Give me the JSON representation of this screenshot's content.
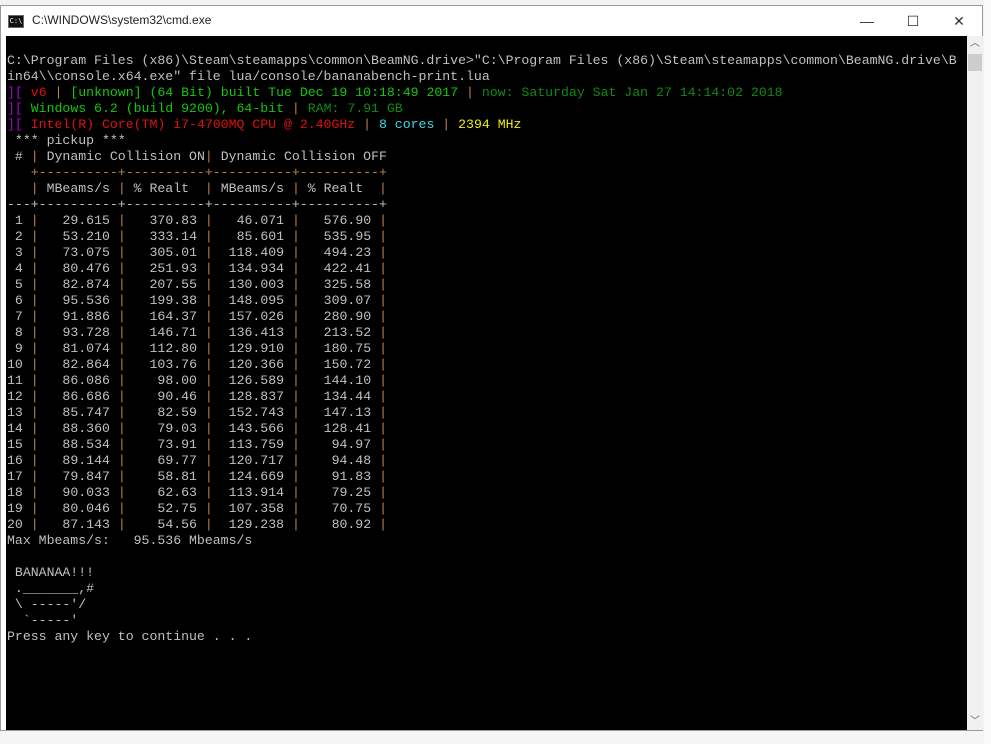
{
  "window": {
    "title": "C:\\WINDOWS\\system32\\cmd.exe",
    "icon_text": "C:\\",
    "minimize": "—",
    "maximize": "☐",
    "close": "✕"
  },
  "console": {
    "command_line_1": "C:\\Program Files (x86)\\Steam\\steamapps\\common\\BeamNG.drive>\"C:\\Program Files (x86)\\Steam\\steamapps\\common\\BeamNG.drive\\B",
    "command_line_2": "in64\\\\console.x64.exe\" file lua/console/bananabench-print.lua",
    "info1": {
      "bracket": "][ ",
      "version": "v6",
      "sep": " | ",
      "build": "[unknown] (64 Bit) built Tue Dec 19 10:18:49 2017",
      "now": "now: Saturday Sat Jan 27 14:14:02 2018"
    },
    "info2": {
      "bracket": "][ ",
      "os": "Windows 6.2 (build 9200), 64-bit",
      "sep": " | ",
      "ram": "RAM: 7.91 GB"
    },
    "info3": {
      "bracket": "][ ",
      "cpu": "Intel(R) Core(TM) i7-4700MQ CPU @ 2.40GHz",
      "sep": " | ",
      "cores": "8 cores",
      "mhz": "2394 MHz"
    },
    "section": " *** pickup ***",
    "table": {
      "header_index": " # ",
      "group_on": " Dynamic Collision ON",
      "group_off": " Dynamic Collision OFF",
      "border": "   +----------+----------+----------+----------+",
      "columns": [
        " MBeams/s ",
        " % Realt  ",
        " MBeams/s ",
        " % Realt  "
      ],
      "separator": "---+----------+----------+----------+----------+",
      "rows": [
        [
          "1",
          "29.615",
          "370.83",
          "46.071",
          "576.90"
        ],
        [
          "2",
          "53.210",
          "333.14",
          "85.601",
          "535.95"
        ],
        [
          "3",
          "73.075",
          "305.01",
          "118.409",
          "494.23"
        ],
        [
          "4",
          "80.476",
          "251.93",
          "134.934",
          "422.41"
        ],
        [
          "5",
          "82.874",
          "207.55",
          "130.003",
          "325.58"
        ],
        [
          "6",
          "95.536",
          "199.38",
          "148.095",
          "309.07"
        ],
        [
          "7",
          "91.886",
          "164.37",
          "157.026",
          "280.90"
        ],
        [
          "8",
          "93.728",
          "146.71",
          "136.413",
          "213.52"
        ],
        [
          "9",
          "81.074",
          "112.80",
          "129.910",
          "180.75"
        ],
        [
          "10",
          "82.864",
          "103.76",
          "120.366",
          "150.72"
        ],
        [
          "11",
          "86.086",
          "98.00",
          "126.589",
          "144.10"
        ],
        [
          "12",
          "86.686",
          "90.46",
          "128.837",
          "134.44"
        ],
        [
          "13",
          "85.747",
          "82.59",
          "152.743",
          "147.13"
        ],
        [
          "14",
          "88.360",
          "79.03",
          "143.566",
          "128.41"
        ],
        [
          "15",
          "88.534",
          "73.91",
          "113.759",
          "94.97"
        ],
        [
          "16",
          "89.144",
          "69.77",
          "120.717",
          "94.48"
        ],
        [
          "17",
          "79.847",
          "58.81",
          "124.669",
          "91.83"
        ],
        [
          "18",
          "90.033",
          "62.63",
          "113.914",
          "79.25"
        ],
        [
          "19",
          "80.046",
          "52.75",
          "107.358",
          "70.75"
        ],
        [
          "20",
          "87.143",
          "54.56",
          "129.238",
          "80.92"
        ]
      ]
    },
    "max_line": "Max Mbeams/s:   95.536 Mbeams/s",
    "banana": [
      " BANANAA!!!",
      " ._______,#",
      " \\ -----'/",
      "  `-----'"
    ],
    "prompt": "Press any key to continue . . ."
  },
  "colors": {
    "background": "#000000",
    "pipe": "#c08040",
    "magenta": "#b000d0",
    "red": "#e01010",
    "green": "#16c60c",
    "dark_green": "#118a11",
    "cyan": "#3ad8e8",
    "yellow": "#f0f000"
  }
}
